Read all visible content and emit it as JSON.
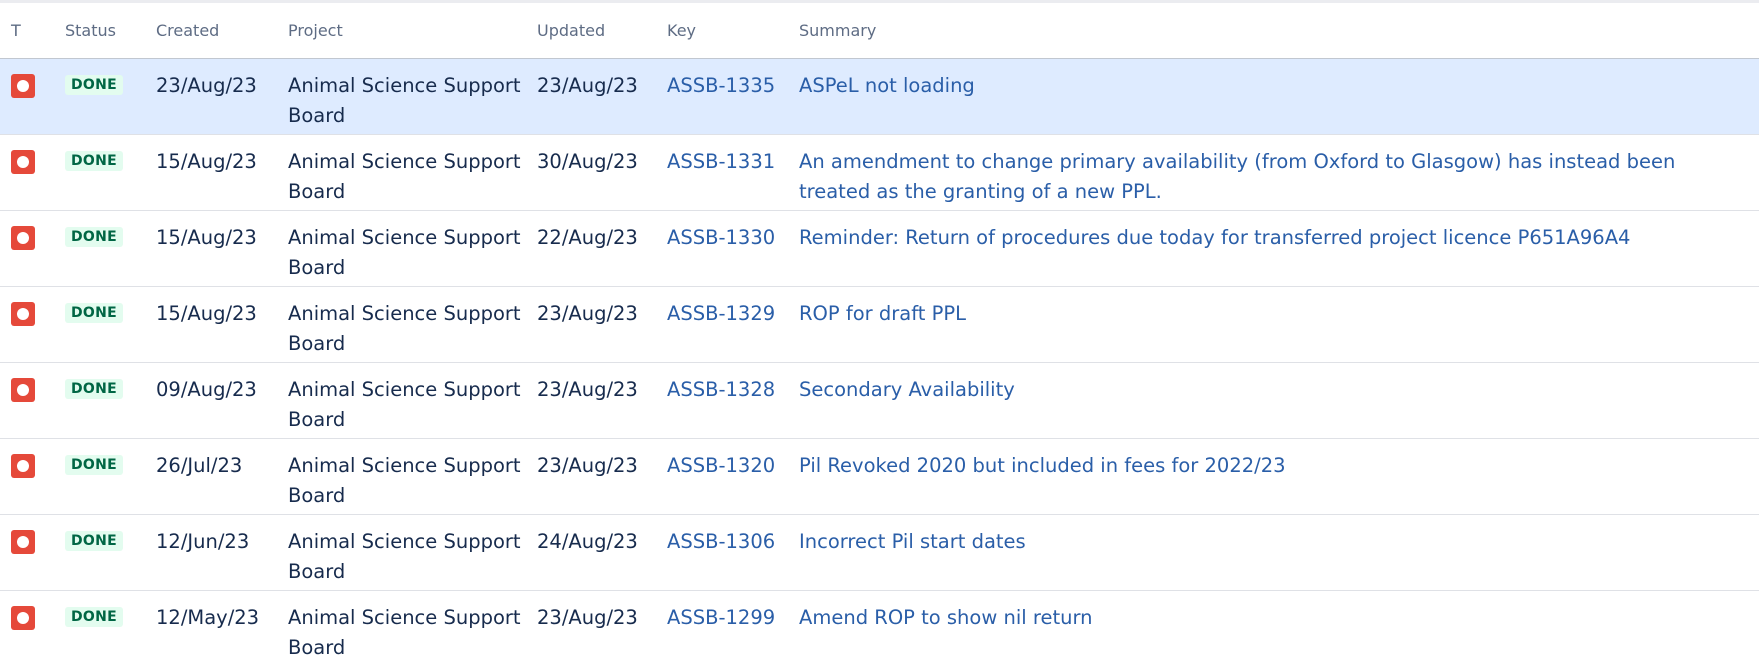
{
  "table": {
    "headers": {
      "type": "T",
      "status": "Status",
      "created": "Created",
      "project": "Project",
      "updated": "Updated",
      "key": "Key",
      "summary": "Summary"
    },
    "rows": [
      {
        "status": "DONE",
        "created": "23/Aug/23",
        "project": "Animal Science Support Board",
        "updated": "23/Aug/23",
        "key": "ASSB-1335",
        "summary": "ASPeL not loading",
        "highlighted": true
      },
      {
        "status": "DONE",
        "created": "15/Aug/23",
        "project": "Animal Science Support Board",
        "updated": "30/Aug/23",
        "key": "ASSB-1331",
        "summary": "An amendment to change primary availability (from Oxford to Glasgow) has instead been treated as the granting of a new PPL."
      },
      {
        "status": "DONE",
        "created": "15/Aug/23",
        "project": "Animal Science Support Board",
        "updated": "22/Aug/23",
        "key": "ASSB-1330",
        "summary": "Reminder: Return of procedures due today for transferred project licence P651A96A4"
      },
      {
        "status": "DONE",
        "created": "15/Aug/23",
        "project": "Animal Science Support Board",
        "updated": "23/Aug/23",
        "key": "ASSB-1329",
        "summary": "ROP for draft PPL"
      },
      {
        "status": "DONE",
        "created": "09/Aug/23",
        "project": "Animal Science Support Board",
        "updated": "23/Aug/23",
        "key": "ASSB-1328",
        "summary": "Secondary Availability"
      },
      {
        "status": "DONE",
        "created": "26/Jul/23",
        "project": "Animal Science Support Board",
        "updated": "23/Aug/23",
        "key": "ASSB-1320",
        "summary": "Pil Revoked 2020 but included in fees for 2022/23"
      },
      {
        "status": "DONE",
        "created": "12/Jun/23",
        "project": "Animal Science Support Board",
        "updated": "24/Aug/23",
        "key": "ASSB-1306",
        "summary": "Incorrect Pil start dates"
      },
      {
        "status": "DONE",
        "created": "12/May/23",
        "project": "Animal Science Support Board",
        "updated": "23/Aug/23",
        "key": "ASSB-1299",
        "summary": "Amend ROP to show nil return"
      }
    ]
  },
  "icons": {
    "issue_type": "bug-icon"
  },
  "colors": {
    "highlight_row": "#deebff",
    "bug_icon": "#e5493a",
    "done_lozenge_bg": "#e3fcef",
    "done_lozenge_text": "#006644",
    "link": "#2a5ea8"
  }
}
